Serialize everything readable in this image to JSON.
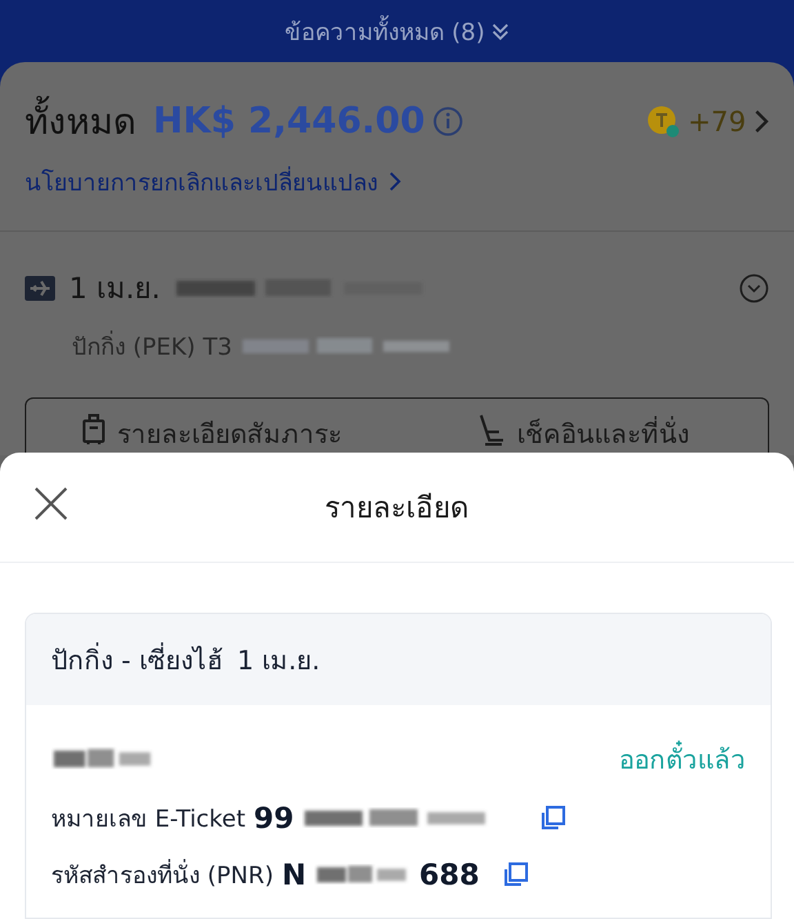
{
  "header": {
    "title": "ข้อความทั้งหมด (8)"
  },
  "summary": {
    "label": "ทั้งหมด",
    "price": "HK$ 2,446.00",
    "points": "+79",
    "policy_link": "นโยบายการยกเลิกและเปลี่ยนแปลง"
  },
  "flight": {
    "date": "1 เม.ย.",
    "departure": "ปักกิ่ง (PEK) T3",
    "expanded": false
  },
  "actions": [
    {
      "label": "รายละเอียดสัมภาระ",
      "kind": "baggage"
    },
    {
      "label": "เช็คอินและที่นั่ง",
      "kind": "checkin"
    }
  ],
  "sheet": {
    "title": "รายละเอียด",
    "route": "ปักกิ่ง - เซี่ยงไฮ้",
    "date": "1 เม.ย.",
    "status": "ออกตั๋วแล้ว",
    "fields": [
      {
        "label": "หมายเลข E-Ticket",
        "value_start": "99"
      },
      {
        "label": "รหัสสำรองที่นั่ง (PNR)",
        "value_start": "N",
        "value_end": "688"
      }
    ]
  }
}
